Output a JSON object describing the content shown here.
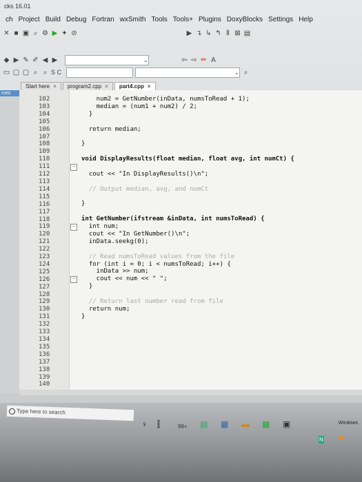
{
  "window": {
    "title_fragment": "cks 16.01"
  },
  "menu": [
    "ch",
    "Project",
    "Build",
    "Debug",
    "Fortran",
    "wxSmith",
    "Tools",
    "Tools+",
    "Plugins",
    "DoxyBlocks",
    "Settings",
    "Help"
  ],
  "search_toolbar": {
    "text": "S C"
  },
  "tabs": [
    {
      "label": "Start here",
      "active": false
    },
    {
      "label": "program2.cpp",
      "active": false
    },
    {
      "label": "part4.cpp",
      "active": true
    }
  ],
  "side_panel": {
    "label": "rces"
  },
  "editor": {
    "line_numbers": [
      "102",
      "103",
      "104",
      "105",
      "106",
      "107",
      "108",
      "109",
      "110",
      "111",
      "112",
      "113",
      "114",
      "115",
      "116",
      "117",
      "118",
      "119",
      "120",
      "121",
      "122",
      "123",
      "124",
      "125",
      "126",
      "127",
      "128",
      "129",
      "130",
      "131",
      "132",
      "133",
      "134",
      "135",
      "136",
      "137",
      "138",
      "139",
      "140"
    ],
    "code": [
      "    num2 = GetNumber(inData, numsToRead + 1);",
      "    median = (num1 + num2) / 2;",
      "  }",
      "",
      "  return median;",
      "",
      "}",
      "",
      "void DisplayResults(float median, float avg, int numCt) {",
      "",
      "  cout << \"In DisplayResults()\\n\";",
      "",
      "  // Output median, avg, and numCt",
      "",
      "}",
      "",
      "int GetNumber(ifstream &inData, int numsToRead) {",
      "  int num;",
      "  cout << \"In GetNumber()\\n\";",
      "  inData.seekg(0);",
      "",
      "  // Read numsToRead values from the file",
      "  for (int i = 0; i < numsToRead; i++) {",
      "    inData >> num;",
      "    cout << num << \" \";",
      "  }",
      "",
      "  // Return last number read from file",
      "  return num;",
      "}",
      "",
      "",
      "",
      "",
      "",
      "",
      "",
      "",
      ""
    ]
  },
  "taskbar": {
    "search_placeholder": "Type here to search",
    "tray_text": "Windows",
    "badge": "99+"
  }
}
